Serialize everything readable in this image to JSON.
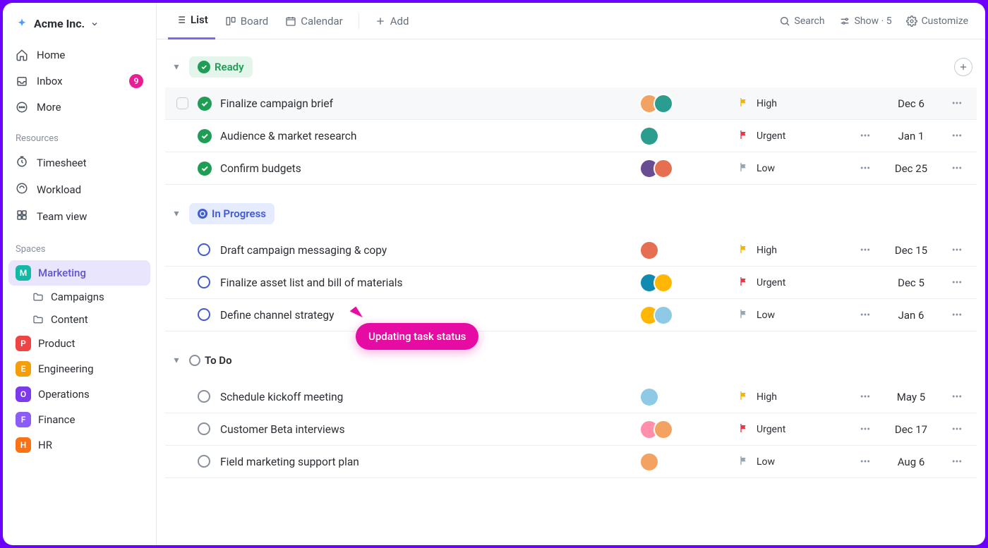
{
  "workspace": {
    "name": "Acme Inc."
  },
  "nav": {
    "home": "Home",
    "inbox": "Inbox",
    "inbox_badge": "9",
    "more": "More"
  },
  "sections": {
    "resources": "Resources",
    "spaces": "Spaces"
  },
  "resources": [
    {
      "key": "timesheet",
      "label": "Timesheet"
    },
    {
      "key": "workload",
      "label": "Workload"
    },
    {
      "key": "teamview",
      "label": "Team view"
    }
  ],
  "spaces": [
    {
      "key": "marketing",
      "letter": "M",
      "color": "#14b8a6",
      "label": "Marketing",
      "active": true,
      "folders": [
        {
          "key": "campaigns",
          "label": "Campaigns"
        },
        {
          "key": "content",
          "label": "Content"
        }
      ]
    },
    {
      "key": "product",
      "letter": "P",
      "color": "#ef4444",
      "label": "Product"
    },
    {
      "key": "engineering",
      "letter": "E",
      "color": "#f59e0b",
      "label": "Engineering"
    },
    {
      "key": "operations",
      "letter": "O",
      "color": "#7c3aed",
      "label": "Operations"
    },
    {
      "key": "finance",
      "letter": "F",
      "color": "#8b5cf6",
      "label": "Finance"
    },
    {
      "key": "hr",
      "letter": "H",
      "color": "#f97316",
      "label": "HR"
    }
  ],
  "views": {
    "list": "List",
    "board": "Board",
    "calendar": "Calendar",
    "add": "Add"
  },
  "tools": {
    "search": "Search",
    "show": "Show · 5",
    "customize": "Customize"
  },
  "priorities": {
    "high": {
      "label": "High",
      "color": "#f5b400"
    },
    "urgent": {
      "label": "Urgent",
      "color": "#e63946"
    },
    "low": {
      "label": "Low",
      "color": "#9aa3af"
    }
  },
  "avatar_colors": [
    "#f4a261",
    "#2a9d8f",
    "#6a4c93",
    "#e76f51",
    "#118ab2",
    "#ffb703",
    "#8ecae6",
    "#ff8fab"
  ],
  "groups": [
    {
      "key": "ready",
      "label": "Ready",
      "chip": "chip-ready",
      "show_add": true,
      "tasks": [
        {
          "title": "Finalize campaign brief",
          "status": "done",
          "assignees": 2,
          "priority": "high",
          "subtasks": false,
          "date": "Dec 6",
          "hovered": true
        },
        {
          "title": "Audience & market research",
          "status": "done",
          "assignees": 1,
          "priority": "urgent",
          "subtasks": true,
          "date": "Jan 1"
        },
        {
          "title": "Confirm budgets",
          "status": "done",
          "assignees": 2,
          "priority": "low",
          "subtasks": true,
          "date": "Dec 25"
        }
      ]
    },
    {
      "key": "progress",
      "label": "In Progress",
      "chip": "chip-progress",
      "tasks": [
        {
          "title": "Draft campaign messaging & copy",
          "status": "progress",
          "assignees": 1,
          "priority": "high",
          "subtasks": true,
          "date": "Dec 15"
        },
        {
          "title": "Finalize asset list and bill of materials",
          "status": "progress",
          "assignees": 2,
          "priority": "urgent",
          "subtasks": false,
          "date": "Dec 5"
        },
        {
          "title": "Define channel strategy",
          "status": "progress",
          "assignees": 2,
          "priority": "low",
          "subtasks": true,
          "date": "Jan 6"
        }
      ]
    },
    {
      "key": "todo",
      "label": "To Do",
      "chip": "chip-todo",
      "tasks": [
        {
          "title": "Schedule kickoff meeting",
          "status": "todo",
          "assignees": 1,
          "priority": "high",
          "subtasks": true,
          "date": "May 5"
        },
        {
          "title": "Customer Beta interviews",
          "status": "todo",
          "assignees": 2,
          "priority": "urgent",
          "subtasks": true,
          "date": "Dec 17"
        },
        {
          "title": "Field marketing support plan",
          "status": "todo",
          "assignees": 1,
          "priority": "low",
          "subtasks": true,
          "date": "Aug 6"
        }
      ]
    }
  ],
  "tooltip": "Updating task status"
}
